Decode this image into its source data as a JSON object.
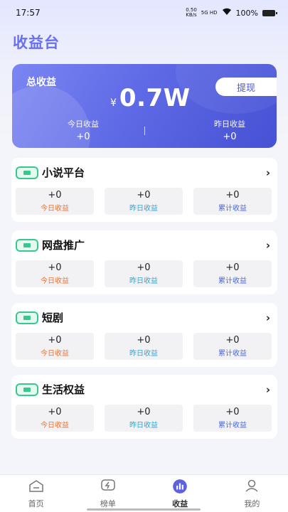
{
  "status_bar": {
    "time": "17:57",
    "net_speed_value": "0.50",
    "net_speed_unit": "KB/s",
    "signal_text": "5G HD",
    "battery": "100%"
  },
  "page": {
    "title": "收益台"
  },
  "summary": {
    "label": "总收益",
    "withdraw_label": "提现",
    "currency": "¥",
    "amount": "0.7W",
    "today_label": "今日收益",
    "today_value": "+0",
    "yesterday_label": "昨日收益",
    "yesterday_value": "+0"
  },
  "sections": [
    {
      "title": "小说平台",
      "cells": [
        {
          "value": "+0",
          "label": "今日收益"
        },
        {
          "value": "+0",
          "label": "昨日收益"
        },
        {
          "value": "+0",
          "label": "累计收益"
        }
      ]
    },
    {
      "title": "网盘推广",
      "cells": [
        {
          "value": "+0",
          "label": "今日收益"
        },
        {
          "value": "+0",
          "label": "昨日收益"
        },
        {
          "value": "+0",
          "label": "累计收益"
        }
      ]
    },
    {
      "title": "短剧",
      "cells": [
        {
          "value": "+0",
          "label": "今日收益"
        },
        {
          "value": "+0",
          "label": "昨日收益"
        },
        {
          "value": "+0",
          "label": "累计收益"
        }
      ]
    },
    {
      "title": "生活权益",
      "cells": [
        {
          "value": "+0",
          "label": "今日收益"
        },
        {
          "value": "+0",
          "label": "昨日收益"
        },
        {
          "value": "+0",
          "label": "累计收益"
        }
      ]
    }
  ],
  "nav": {
    "items": [
      {
        "label": "首页",
        "icon": "home-icon"
      },
      {
        "label": "榜单",
        "icon": "ranking-icon"
      },
      {
        "label": "收益",
        "icon": "earnings-icon"
      },
      {
        "label": "我的",
        "icon": "profile-icon"
      }
    ],
    "active": "收益"
  },
  "colors": {
    "accent": "#5f6ae6",
    "title": "#6a6ff0",
    "today": "#e8743b",
    "yesterday": "#2aa7d8",
    "total": "#4a68d8",
    "badge": "#36c98f"
  }
}
